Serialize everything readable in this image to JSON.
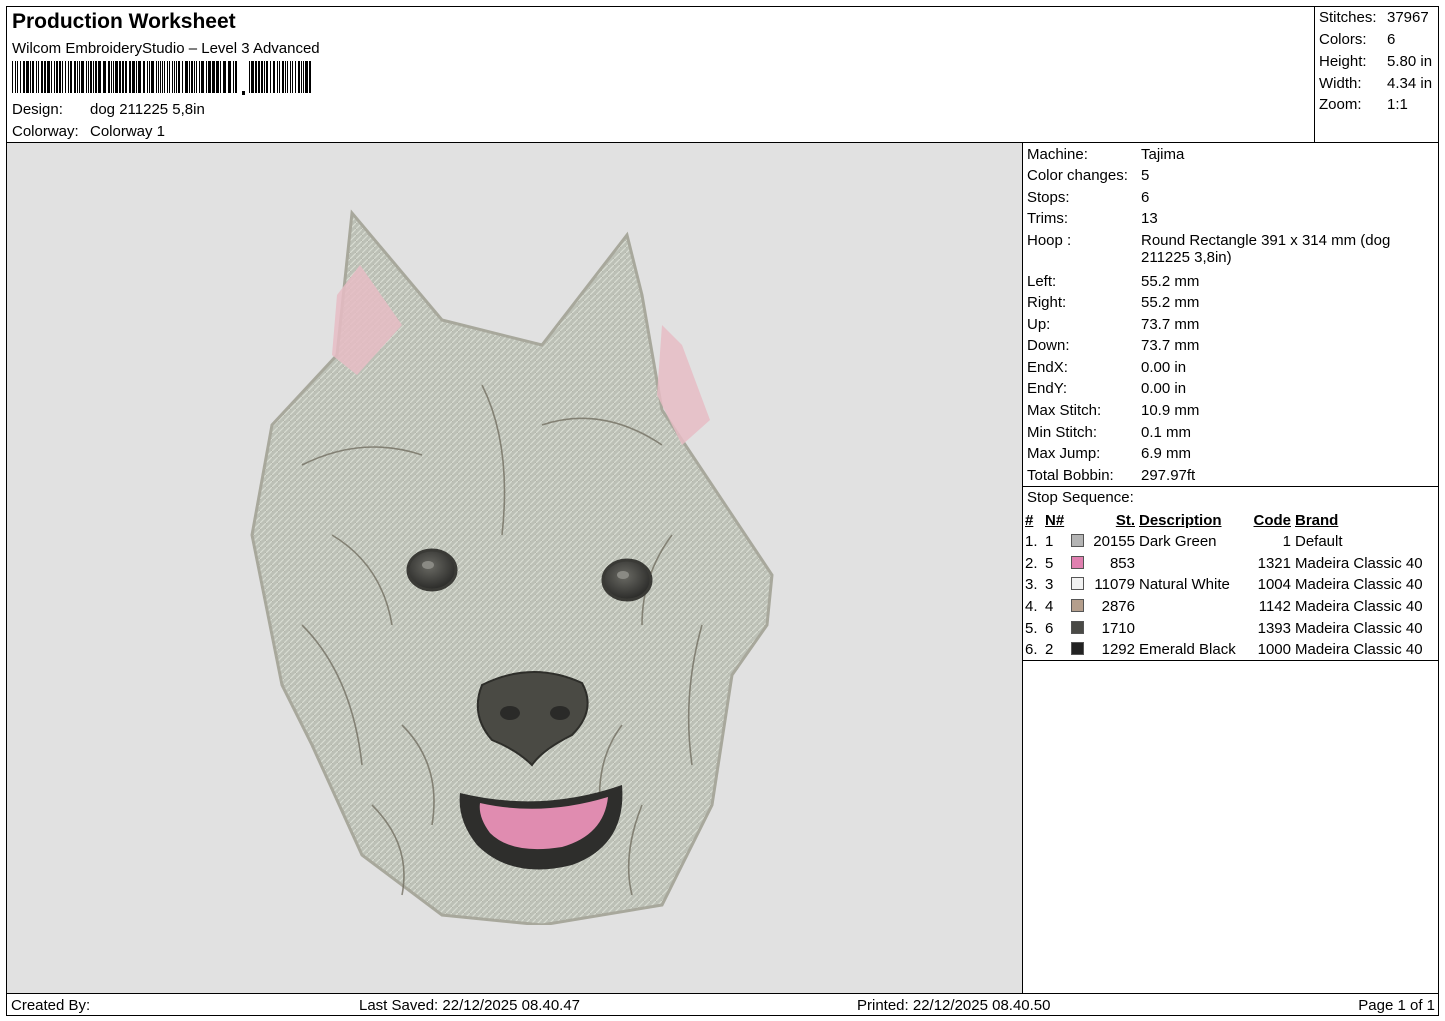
{
  "header": {
    "title": "Production Worksheet",
    "software": "Wilcom EmbroideryStudio – Level 3 Advanced",
    "design_label": "Design:",
    "design_value": "dog 211225 5,8in",
    "colorway_label": "Colorway:",
    "colorway_value": "Colorway 1"
  },
  "stats": [
    {
      "label": "Stitches:",
      "value": "37967"
    },
    {
      "label": "Colors:",
      "value": "6"
    },
    {
      "label": "Height:",
      "value": "5.80 in"
    },
    {
      "label": "Width:",
      "value": "4.34 in"
    },
    {
      "label": "Zoom:",
      "value": "1:1"
    }
  ],
  "info": [
    {
      "label": "Machine:",
      "value": "Tajima"
    },
    {
      "label": "Color changes:",
      "value": "5"
    },
    {
      "label": "Stops:",
      "value": "6"
    },
    {
      "label": "Trims:",
      "value": "13"
    },
    {
      "label": "Hoop :",
      "value": "Round Rectangle 391 x 314 mm (dog 211225 3,8in)"
    },
    {
      "label": "Left:",
      "value": "55.2 mm"
    },
    {
      "label": "Right:",
      "value": "55.2 mm"
    },
    {
      "label": "Up:",
      "value": "73.7 mm"
    },
    {
      "label": "Down:",
      "value": "73.7 mm"
    },
    {
      "label": "EndX:",
      "value": "0.00 in"
    },
    {
      "label": "EndY:",
      "value": "0.00 in"
    },
    {
      "label": "Max Stitch:",
      "value": "10.9 mm"
    },
    {
      "label": "Min Stitch:",
      "value": "0.1 mm"
    },
    {
      "label": "Max Jump:",
      "value": "6.9 mm"
    },
    {
      "label": "Total Bobbin:",
      "value": "297.97ft"
    }
  ],
  "stop_sequence": {
    "title": "Stop Sequence:",
    "headers": {
      "idx": "#",
      "n": "N#",
      "st": "St.",
      "description": "Description",
      "code": "Code",
      "brand": "Brand"
    },
    "rows": [
      {
        "idx": "1.",
        "n": "1",
        "color": "#b4b4b4",
        "st": "20155",
        "description": "Dark Green",
        "code": "1",
        "brand": "Default"
      },
      {
        "idx": "2.",
        "n": "5",
        "color": "#e080b0",
        "st": "853",
        "description": "",
        "code": "1321",
        "brand": "Madeira Classic 40"
      },
      {
        "idx": "3.",
        "n": "3",
        "color": "#f2f2f2",
        "st": "11079",
        "description": "Natural White",
        "code": "1004",
        "brand": "Madeira Classic 40"
      },
      {
        "idx": "4.",
        "n": "4",
        "color": "#b49e8c",
        "st": "2876",
        "description": "",
        "code": "1142",
        "brand": "Madeira Classic 40"
      },
      {
        "idx": "5.",
        "n": "6",
        "color": "#4a4a46",
        "st": "1710",
        "description": "",
        "code": "1393",
        "brand": "Madeira Classic 40"
      },
      {
        "idx": "6.",
        "n": "2",
        "color": "#222222",
        "st": "1292",
        "description": "Emerald Black",
        "code": "1000",
        "brand": "Madeira Classic 40"
      }
    ]
  },
  "footer": {
    "created_by": "Created By:",
    "last_saved": "Last Saved: 22/12/2025 08.40.47",
    "printed": "Printed: 22/12/2025 08.40.50",
    "page": "Page 1 of 1"
  },
  "colors": {
    "design_background": "#e1e1e1",
    "fur": "#b8bcb2",
    "fur_dark": "#7a7668",
    "ear_pink": "#e6b8c2",
    "tongue": "#e08cb0"
  }
}
